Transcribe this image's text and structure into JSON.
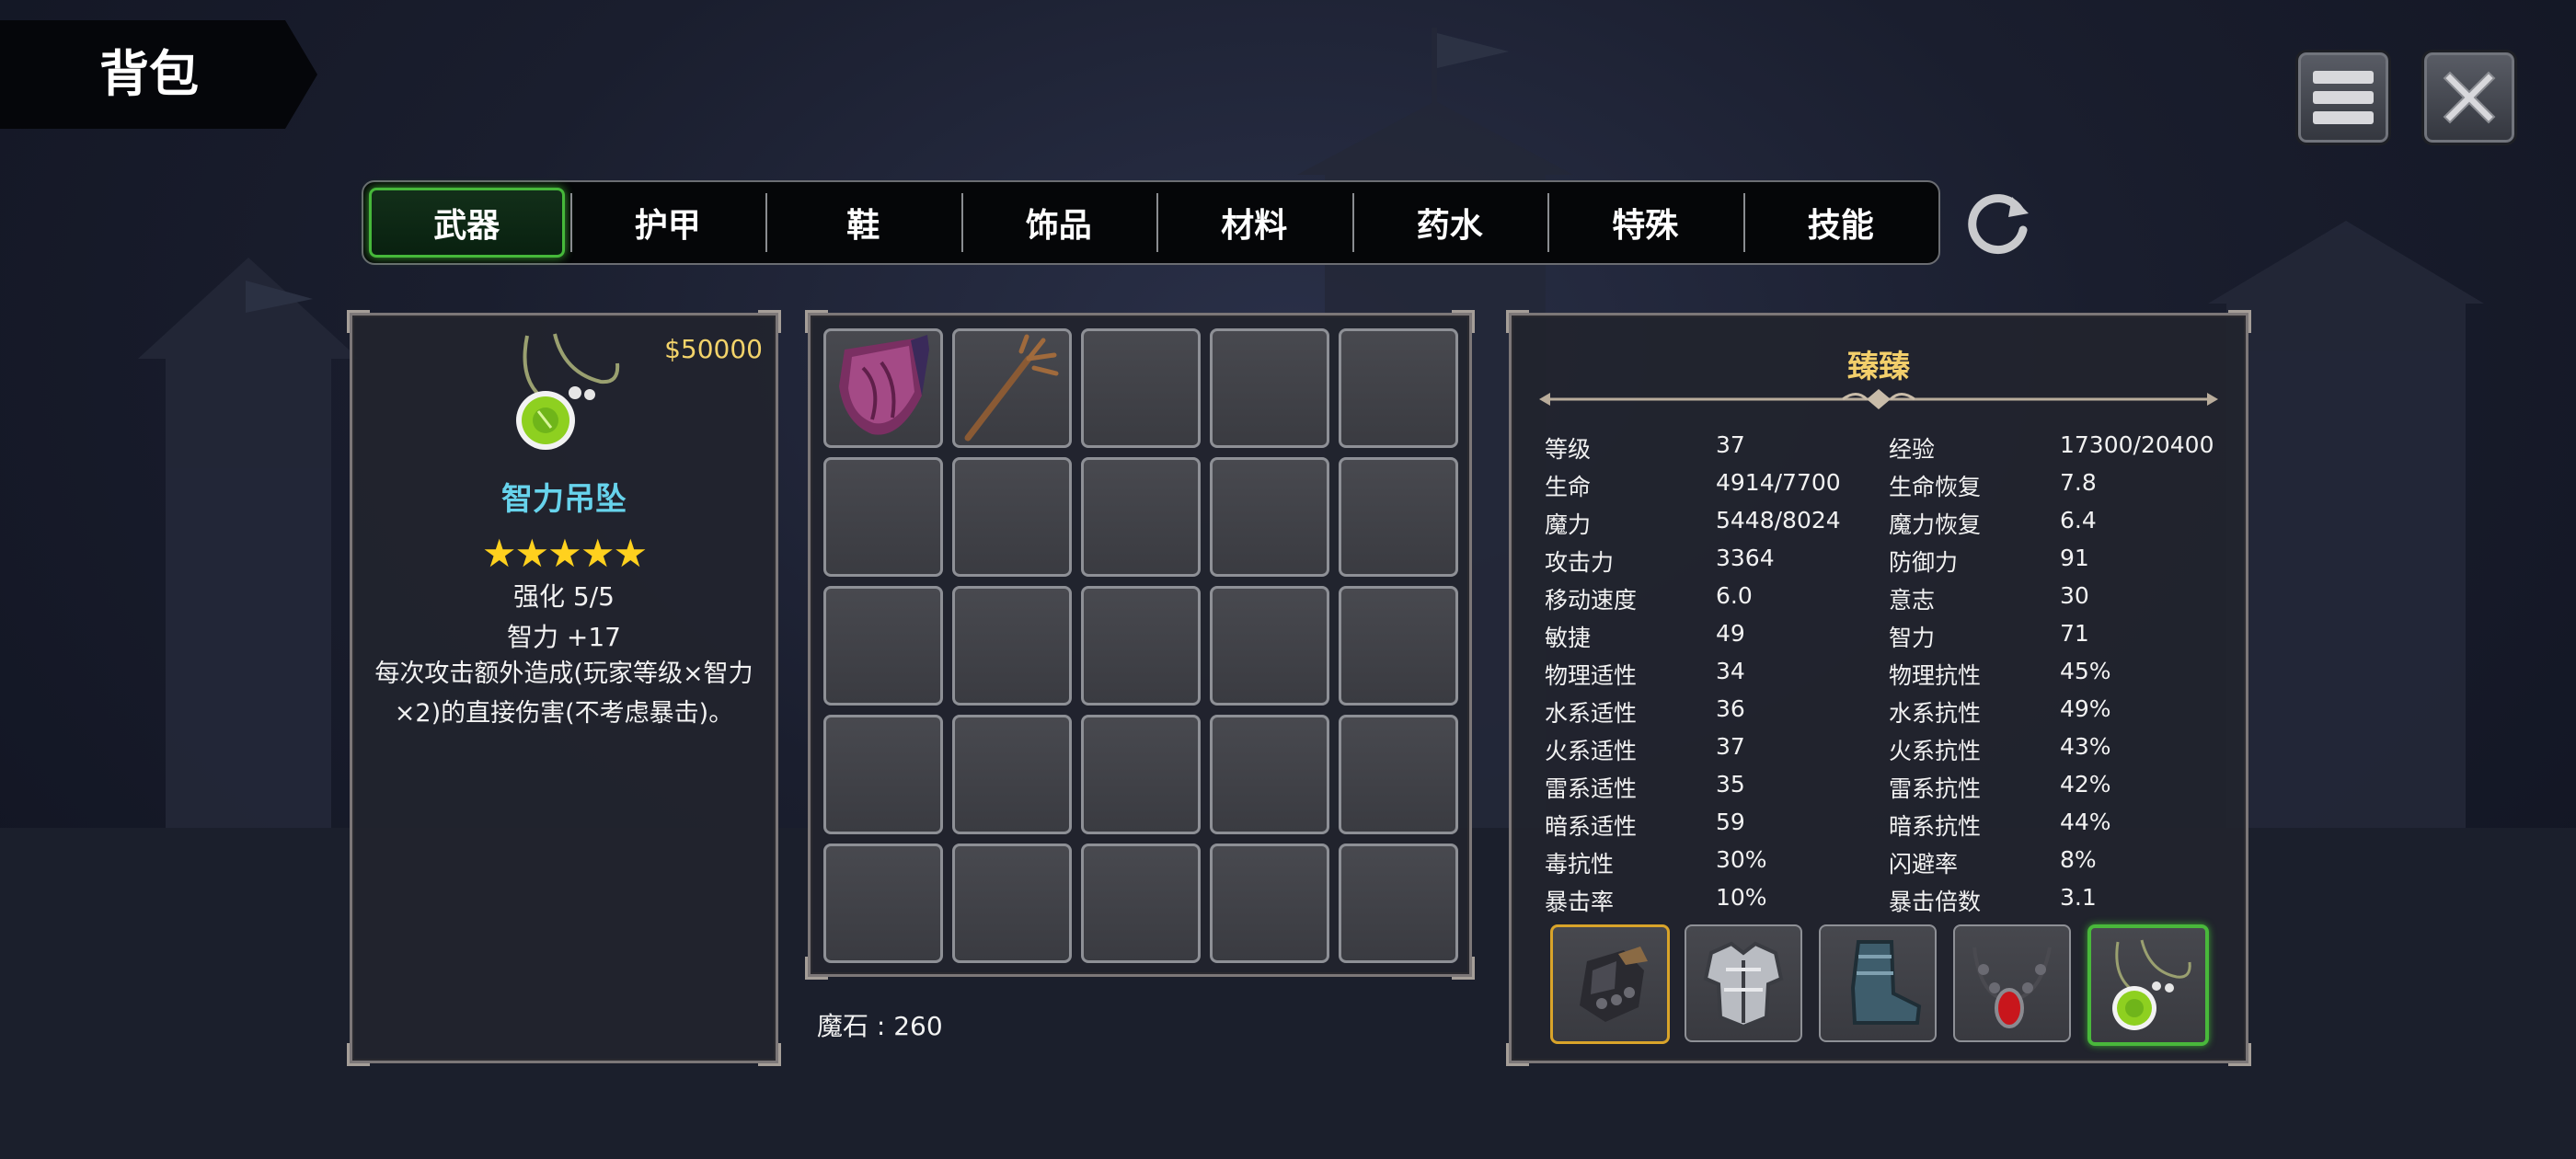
{
  "header": {
    "title": "背包"
  },
  "toolbar": {
    "menu_icon": "menu-icon",
    "close_icon": "close-icon",
    "refresh_icon": "refresh-icon"
  },
  "tabs": [
    {
      "label": "武器",
      "active": true
    },
    {
      "label": "护甲"
    },
    {
      "label": "鞋"
    },
    {
      "label": "饰品"
    },
    {
      "label": "材料"
    },
    {
      "label": "药水"
    },
    {
      "label": "特殊"
    },
    {
      "label": "技能"
    }
  ],
  "item_detail": {
    "price": "$50000",
    "icon": "green-pendant-icon",
    "name": "智力吊坠",
    "stars": "★★★★★",
    "enhance": "强化 5/5",
    "bonus": "智力  +17",
    "description": "每次攻击额外造成(玩家等级×智力×2)的直接伤害(不考虑暴击)。"
  },
  "inventory": {
    "slots_icons": [
      "purple-cloak-icon",
      "wooden-staff-icon"
    ],
    "magic_stone": "魔石 : 260"
  },
  "character": {
    "name": "臻臻",
    "stats": [
      {
        "label": "等级",
        "value": "37",
        "label2": "经验",
        "value2": "17300/20400"
      },
      {
        "label": "生命",
        "value": "4914/7700",
        "label2": "生命恢复",
        "value2": "7.8"
      },
      {
        "label": "魔力",
        "value": "5448/8024",
        "label2": "魔力恢复",
        "value2": "6.4"
      },
      {
        "label": "攻击力",
        "value": "3364",
        "label2": "防御力",
        "value2": "91"
      },
      {
        "label": "移动速度",
        "value": "6.0",
        "label2": "意志",
        "value2": "30"
      },
      {
        "label": "敏捷",
        "value": "49",
        "label2": "智力",
        "value2": "71"
      },
      {
        "label": "物理适性",
        "value": "34",
        "label2": "物理抗性",
        "value2": "45%"
      },
      {
        "label": "水系适性",
        "value": "36",
        "label2": "水系抗性",
        "value2": "49%"
      },
      {
        "label": "火系适性",
        "value": "37",
        "label2": "火系抗性",
        "value2": "43%"
      },
      {
        "label": "雷系适性",
        "value": "35",
        "label2": "雷系抗性",
        "value2": "42%"
      },
      {
        "label": "暗系适性",
        "value": "59",
        "label2": "暗系抗性",
        "value2": "44%"
      },
      {
        "label": "毒抗性",
        "value": "30%",
        "label2": "闪避率",
        "value2": "8%"
      },
      {
        "label": "暴击率",
        "value": "10%",
        "label2": "暴击倍数",
        "value2": "3.1"
      }
    ],
    "equipment": [
      "gauntlet-icon",
      "chest-armor-icon",
      "boots-icon",
      "red-necklace-icon",
      "green-pendant-icon"
    ]
  },
  "colors": {
    "accent_green": "#46b83a",
    "gold": "#f3d36a",
    "cyan": "#67d3ec",
    "star": "#ffd11e"
  }
}
